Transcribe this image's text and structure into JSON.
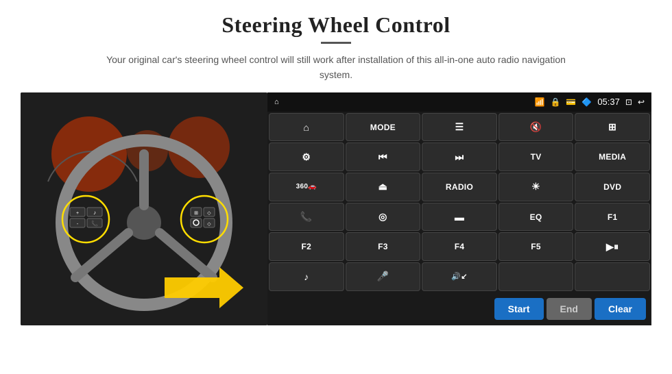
{
  "header": {
    "title": "Steering Wheel Control",
    "divider": true,
    "subtitle": "Your original car's steering wheel control will still work after installation of this all-in-one auto radio navigation system."
  },
  "status_bar": {
    "time": "05:37",
    "icons": [
      "wifi",
      "lock",
      "card",
      "bluetooth",
      "battery",
      "window",
      "back"
    ]
  },
  "button_grid": [
    [
      {
        "id": "home",
        "label": "",
        "icon": "⌂",
        "type": "icon"
      },
      {
        "id": "mode",
        "label": "MODE",
        "type": "text"
      },
      {
        "id": "menu",
        "label": "",
        "icon": "≡",
        "type": "icon"
      },
      {
        "id": "mute",
        "label": "",
        "icon": "🔇",
        "type": "icon"
      },
      {
        "id": "apps",
        "label": "",
        "icon": "⊞",
        "type": "icon"
      }
    ],
    [
      {
        "id": "settings",
        "label": "",
        "icon": "⚙",
        "type": "icon"
      },
      {
        "id": "rewind",
        "label": "",
        "icon": "⏮",
        "type": "icon"
      },
      {
        "id": "forward",
        "label": "",
        "icon": "⏭",
        "type": "icon"
      },
      {
        "id": "tv",
        "label": "TV",
        "type": "text"
      },
      {
        "id": "media",
        "label": "MEDIA",
        "type": "text"
      }
    ],
    [
      {
        "id": "cam360",
        "label": "360",
        "icon": "360",
        "type": "icon"
      },
      {
        "id": "eject",
        "label": "",
        "icon": "⏏",
        "type": "icon"
      },
      {
        "id": "radio",
        "label": "RADIO",
        "type": "text"
      },
      {
        "id": "brightness",
        "label": "",
        "icon": "☀",
        "type": "icon"
      },
      {
        "id": "dvd",
        "label": "DVD",
        "type": "text"
      }
    ],
    [
      {
        "id": "phone",
        "label": "",
        "icon": "📞",
        "type": "icon"
      },
      {
        "id": "navigation",
        "label": "",
        "icon": "◎",
        "type": "icon"
      },
      {
        "id": "screen",
        "label": "",
        "icon": "▬",
        "type": "icon"
      },
      {
        "id": "eq",
        "label": "EQ",
        "type": "text"
      },
      {
        "id": "f1",
        "label": "F1",
        "type": "text"
      }
    ],
    [
      {
        "id": "f2",
        "label": "F2",
        "type": "text"
      },
      {
        "id": "f3",
        "label": "F3",
        "type": "text"
      },
      {
        "id": "f4",
        "label": "F4",
        "type": "text"
      },
      {
        "id": "f5",
        "label": "F5",
        "type": "text"
      },
      {
        "id": "playpause",
        "label": "",
        "icon": "▶⏸",
        "type": "icon"
      }
    ],
    [
      {
        "id": "music",
        "label": "",
        "icon": "♪",
        "type": "icon"
      },
      {
        "id": "mic",
        "label": "",
        "icon": "🎤",
        "type": "icon"
      },
      {
        "id": "volume",
        "label": "",
        "icon": "🔊↙",
        "type": "icon"
      },
      {
        "id": "empty1",
        "label": "",
        "type": "empty"
      },
      {
        "id": "empty2",
        "label": "",
        "type": "empty"
      }
    ]
  ],
  "bottom_buttons": {
    "start": "Start",
    "end": "End",
    "clear": "Clear"
  }
}
